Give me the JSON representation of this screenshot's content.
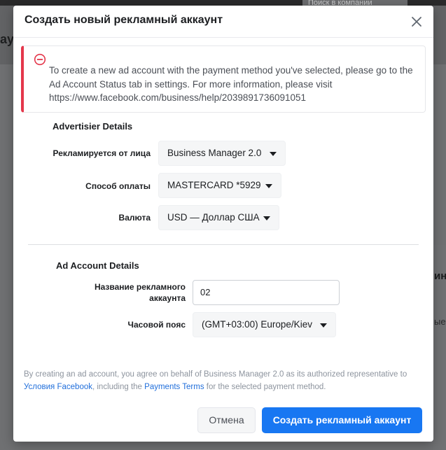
{
  "background": {
    "search_text": "Поиск в компании",
    "heading_fragment": "ау",
    "right_fragment_1": "ин",
    "right_fragment_2": "ые"
  },
  "modal": {
    "title": "Создать новый рекламный аккаунт",
    "alert": {
      "icon": "error-circle-icon",
      "color": "#e4374b",
      "text": "To create a new ad account with the payment method you've selected, please go to the Ad Account Status tab in settings. For more information, please visit https://www.facebook.com/business/help/2039891736091051"
    },
    "advertiser_details": {
      "title": "Advertisier Details",
      "advertiser_label": "Рекламируется от лица",
      "advertiser_value": "Business Manager 2.0",
      "payment_label": "Способ оплаты",
      "payment_value": "MASTERCARD *5929",
      "currency_label": "Валюта",
      "currency_value": "USD — Доллар США"
    },
    "ad_account_details": {
      "title": "Ad Account Details",
      "name_label": "Название рекламного аккаунта",
      "name_value": "02",
      "timezone_label": "Часовой пояс",
      "timezone_value": "(GMT+03:00) Europe/Kiev"
    },
    "terms": {
      "part1": "By creating an ad account, you agree on behalf of Business Manager 2.0 as its authorized representative to ",
      "link1": "Условия Facebook",
      "part2": ", including the ",
      "link2": "Payments Terms",
      "part3": " for the selected payment method."
    },
    "buttons": {
      "cancel": "Отмена",
      "create": "Создать рекламный аккаунт"
    },
    "colors": {
      "primary": "#1877f2",
      "link": "#216fdb"
    }
  }
}
